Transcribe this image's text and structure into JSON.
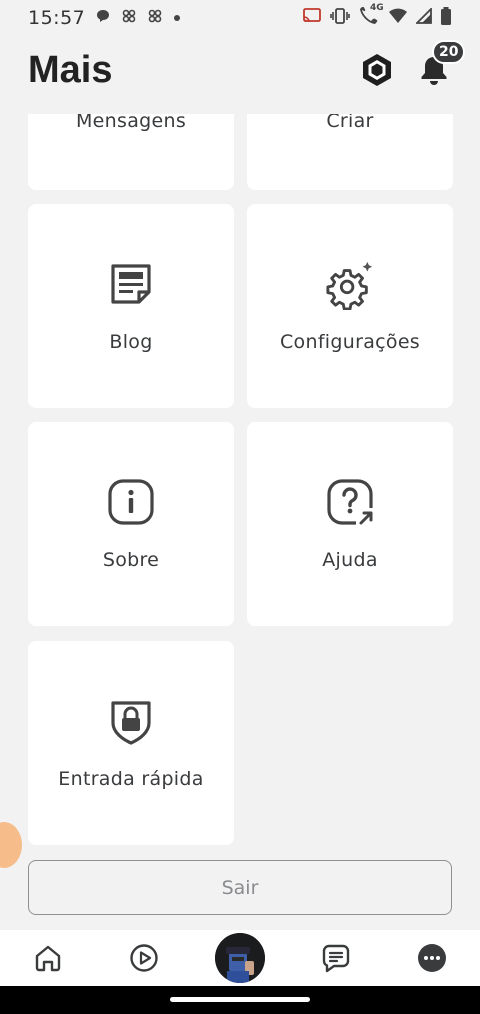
{
  "status_bar": {
    "time": "15:57",
    "network_label": "4G"
  },
  "header": {
    "title": "Mais",
    "notification_count": "20"
  },
  "tiles": {
    "messages": "Mensagens",
    "create": "Criar",
    "blog": "Blog",
    "settings": "Configurações",
    "about": "Sobre",
    "help": "Ajuda",
    "quick_login": "Entrada rápida"
  },
  "logout_label": "Sair",
  "icons": {
    "tiles": [
      "blog-icon",
      "gear-icon",
      "info-icon",
      "help-icon",
      "lock-shield-icon"
    ],
    "nav": [
      "home-icon",
      "play-icon",
      "avatar",
      "chat-icon",
      "more-icon"
    ]
  },
  "colors": {
    "background": "#f2f2f3",
    "tile": "#ffffff",
    "text": "#393b3d",
    "badge": "#393b3d"
  }
}
